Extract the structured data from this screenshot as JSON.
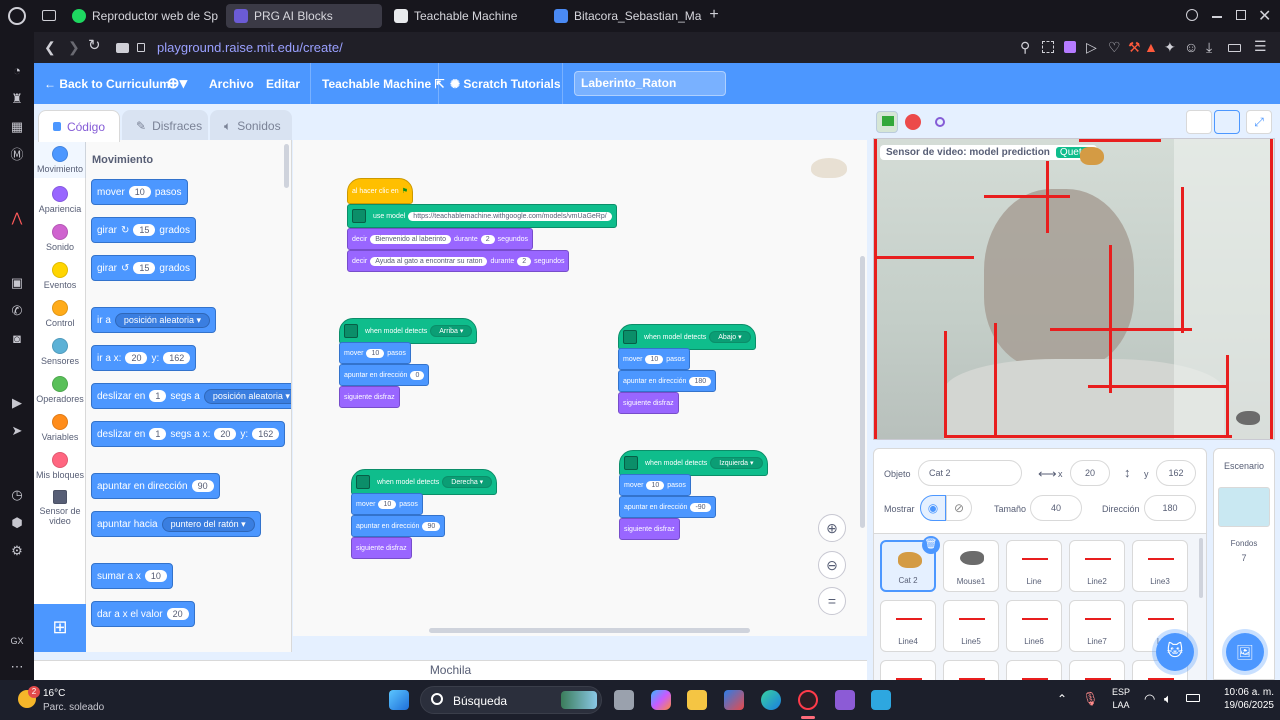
{
  "tabs": [
    {
      "label": "Reproductor web de Spoti",
      "active": false
    },
    {
      "label": "PRG AI Blocks",
      "active": true
    },
    {
      "label": "Teachable Machine",
      "active": false
    },
    {
      "label": "Bitacora_Sebastian_Martin",
      "active": false
    }
  ],
  "url": "playground.raise.mit.edu/create/",
  "menubar": {
    "back": "Back to Curriculum",
    "file": "Archivo",
    "edit": "Editar",
    "teachable": "Teachable Machine",
    "tutorials": "Scratch Tutorials",
    "project_title": "Laberinto_Raton"
  },
  "editor_tabs": {
    "code": "Código",
    "costumes": "Disfraces",
    "sounds": "Sonidos"
  },
  "categories": [
    {
      "label": "Movimiento",
      "color": "#4c97ff"
    },
    {
      "label": "Apariencia",
      "color": "#9966ff"
    },
    {
      "label": "Sonido",
      "color": "#cf63cf"
    },
    {
      "label": "Eventos",
      "color": "#ffd500"
    },
    {
      "label": "Control",
      "color": "#ffab19"
    },
    {
      "label": "Sensores",
      "color": "#5cb1d6"
    },
    {
      "label": "Operadores",
      "color": "#59c059"
    },
    {
      "label": "Variables",
      "color": "#ff8c1a"
    },
    {
      "label": "Mis bloques",
      "color": "#ff6680"
    },
    {
      "label": "Sensor de video",
      "color": "#0fbd8c"
    }
  ],
  "palette": {
    "heading": "Movimiento",
    "move": {
      "a": "mover",
      "n": "10",
      "b": "pasos"
    },
    "turn_right": {
      "a": "girar",
      "n": "15",
      "b": "grados"
    },
    "turn_left": {
      "a": "girar",
      "n": "15",
      "b": "grados"
    },
    "goto": {
      "a": "ir a",
      "drop": "posición aleatoria"
    },
    "goto_xy": {
      "a": "ir a x:",
      "x": "20",
      "b": "y:",
      "y": "162"
    },
    "glide": {
      "a": "deslizar en",
      "n": "1",
      "b": "segs a",
      "drop": "posición aleatoria"
    },
    "glide_xy": {
      "a": "deslizar en",
      "n": "1",
      "b": "segs a x:",
      "x": "20",
      "c": "y:",
      "y": "162"
    },
    "point_dir": {
      "a": "apuntar en dirección",
      "n": "90"
    },
    "point_towards": {
      "a": "apuntar hacia",
      "drop": "puntero del ratón"
    },
    "change_x": {
      "a": "sumar a x",
      "n": "10"
    },
    "set_x": {
      "a": "dar a x el valor",
      "n": "20"
    }
  },
  "scripts": {
    "main": {
      "when_flag": "al hacer clic en",
      "use_model": "use model",
      "model_url": "https://teachablemachine.withgoogle.com/models/vmUaGeRp/",
      "say1": {
        "a": "decir",
        "text": "Bienvenido al laberinto",
        "b": "durante",
        "n": "2",
        "c": "segundos"
      },
      "say2": {
        "a": "decir",
        "text": "Ayuda al gato a encontrar su raton",
        "b": "durante",
        "n": "2",
        "c": "segundos"
      }
    },
    "detect_label": "when model detects",
    "move_label": "mover",
    "steps_label": "pasos",
    "point_label": "apuntar en dirección",
    "next_costume": "siguiente disfraz",
    "up": {
      "class": "Arriba",
      "move": "10",
      "dir": "0"
    },
    "down": {
      "class": "Abajo",
      "move": "10",
      "dir": "180"
    },
    "right": {
      "class": "Derecha",
      "move": "10",
      "dir": "90"
    },
    "left": {
      "class": "Izquierda",
      "move": "10",
      "dir": "-90"
    }
  },
  "backpack": "Mochila",
  "stage": {
    "sensor_label": "Sensor de video: model prediction",
    "sensor_value": "Queto"
  },
  "sprite_info": {
    "sprite_label": "Objeto",
    "sprite_name": "Cat 2",
    "x": "20",
    "y": "162",
    "show_label": "Mostrar",
    "size_label": "Tamaño",
    "size": "40",
    "direction_label": "Dirección",
    "direction": "180"
  },
  "sprites": [
    "Cat 2",
    "Mouse1",
    "Line",
    "Line2",
    "Line3",
    "Line4",
    "Line5",
    "Line6",
    "Line7",
    "Li"
  ],
  "stage_pane": {
    "title": "Escenario",
    "backdrops_label": "Fondos",
    "backdrops_count": "7"
  },
  "taskbar": {
    "temp": "16°C",
    "weather": "Parc. soleado",
    "notif": "2",
    "search": "Búsqueda",
    "lang1": "ESP",
    "lang2": "LAA",
    "time": "10:06 a. m.",
    "date": "19/06/2025"
  }
}
